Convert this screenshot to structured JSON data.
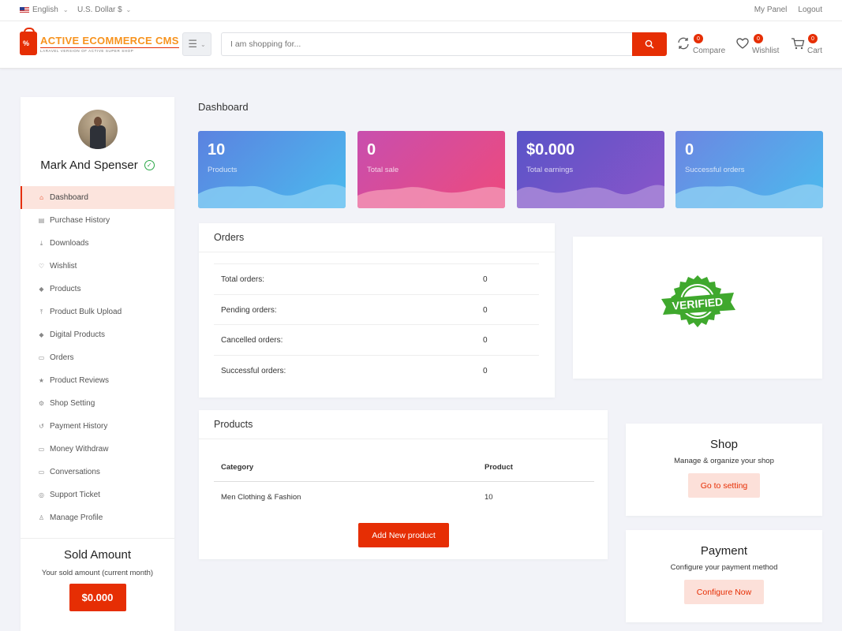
{
  "topbar": {
    "language": "English",
    "currency": "U.S. Dollar $",
    "my_panel": "My Panel",
    "logout": "Logout"
  },
  "header": {
    "logo_name": "ACTIVE ECOMMERCE CMS",
    "logo_tagline": "LARAVEL VERSION OF ACTIVE SUPER SHOP",
    "search_placeholder": "I am shopping for...",
    "compare": {
      "label": "Compare",
      "count": "0"
    },
    "wishlist": {
      "label": "Wishlist",
      "count": "0"
    },
    "cart": {
      "label": "Cart",
      "count": "0"
    }
  },
  "sidebar": {
    "user_name": "Mark And Spenser",
    "items": [
      {
        "label": "Dashboard",
        "icon": "home-icon"
      },
      {
        "label": "Purchase History",
        "icon": "file-icon"
      },
      {
        "label": "Downloads",
        "icon": "download-icon"
      },
      {
        "label": "Wishlist",
        "icon": "heart-icon"
      },
      {
        "label": "Products",
        "icon": "diamond-icon"
      },
      {
        "label": "Product Bulk Upload",
        "icon": "upload-icon"
      },
      {
        "label": "Digital Products",
        "icon": "diamond-icon"
      },
      {
        "label": "Orders",
        "icon": "money-icon"
      },
      {
        "label": "Product Reviews",
        "icon": "star-icon"
      },
      {
        "label": "Shop Setting",
        "icon": "cog-icon"
      },
      {
        "label": "Payment History",
        "icon": "history-icon"
      },
      {
        "label": "Money Withdraw",
        "icon": "money-bill-icon"
      },
      {
        "label": "Conversations",
        "icon": "comment-icon"
      },
      {
        "label": "Support Ticket",
        "icon": "life-ring-icon"
      },
      {
        "label": "Manage Profile",
        "icon": "user-icon"
      }
    ],
    "sold": {
      "title": "Sold Amount",
      "subtitle": "Your sold amount (current month)",
      "amount": "$0.000"
    }
  },
  "main": {
    "title": "Dashboard",
    "stats": [
      {
        "value": "10",
        "label": "Products",
        "from": "#5b82e0",
        "to": "#4bbbee",
        "wave": "#86cdf3"
      },
      {
        "value": "0",
        "label": "Total sale",
        "from": "#c84eae",
        "to": "#ee4a7c",
        "wave": "#f293b4"
      },
      {
        "value": "$0.000",
        "label": "Total earnings",
        "from": "#5a54c8",
        "to": "#8a55c9",
        "wave": "#a98ad8"
      },
      {
        "value": "0",
        "label": "Successful orders",
        "from": "#6c86e2",
        "to": "#4bbbee",
        "wave": "#8ccdf2"
      }
    ],
    "orders": {
      "title": "Orders",
      "rows": [
        {
          "label": "Total orders:",
          "value": "0"
        },
        {
          "label": "Pending orders:",
          "value": "0"
        },
        {
          "label": "Cancelled orders:",
          "value": "0"
        },
        {
          "label": "Successful orders:",
          "value": "0"
        }
      ]
    },
    "verified_text": "VERIFIED",
    "products": {
      "title": "Products",
      "columns": [
        "Category",
        "Product"
      ],
      "rows": [
        {
          "category": "Men Clothing & Fashion",
          "product": "10"
        }
      ],
      "add_button": "Add New product"
    },
    "shop": {
      "title": "Shop",
      "subtitle": "Manage & organize your shop",
      "button": "Go to setting"
    },
    "payment": {
      "title": "Payment",
      "subtitle": "Configure your payment method",
      "button": "Configure Now"
    }
  }
}
